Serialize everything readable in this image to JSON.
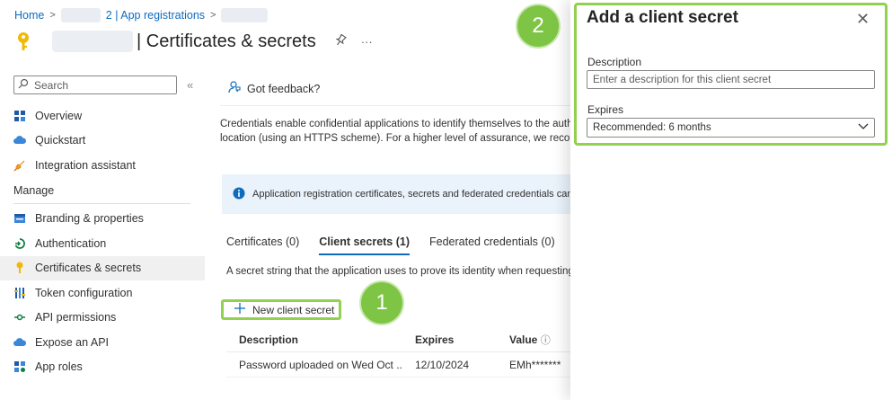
{
  "breadcrumb": {
    "home": "Home",
    "app_registrations": "2 | App registrations"
  },
  "page": {
    "title": "| Certificates & secrets",
    "pin_label": "Pin",
    "more_label": "···"
  },
  "sidebar": {
    "search_placeholder": "Search",
    "collapse_label": "«",
    "items_top": [
      {
        "label": "Overview"
      },
      {
        "label": "Quickstart"
      },
      {
        "label": "Integration assistant"
      }
    ],
    "manage_header": "Manage",
    "items_manage": [
      {
        "label": "Branding & properties"
      },
      {
        "label": "Authentication"
      },
      {
        "label": "Certificates & secrets",
        "active": true
      },
      {
        "label": "Token configuration"
      },
      {
        "label": "API permissions"
      },
      {
        "label": "Expose an API"
      },
      {
        "label": "App roles"
      }
    ]
  },
  "main": {
    "feedback_label": "Got feedback?",
    "description_line1": "Credentials enable confidential applications to identify themselves to the auth",
    "description_line2": "location (using an HTTPS scheme). For a higher level of assurance, we recomm",
    "info_text": "Application registration certificates, secrets and federated credentials can be",
    "tabs": [
      {
        "label": "Certificates (0)"
      },
      {
        "label": "Client secrets (1)",
        "active": true
      },
      {
        "label": "Federated credentials (0)"
      }
    ],
    "tab_description": "A secret string that the application uses to prove its identity when requesting",
    "new_secret_label": "New client secret",
    "table": {
      "headers": [
        "Description",
        "Expires",
        "Value"
      ],
      "rows": [
        {
          "description": "Password uploaded on Wed Oct ...",
          "expires": "12/10/2024",
          "value": "EMh*******"
        }
      ]
    }
  },
  "badges": {
    "one": "1",
    "two": "2"
  },
  "panel": {
    "title": "Add a client secret",
    "close_label": "✕",
    "description_label": "Description",
    "description_placeholder": "Enter a description for this client secret",
    "expires_label": "Expires",
    "expires_value": "Recommended: 6 months"
  },
  "colors": {
    "accent": "#0f6cbd",
    "highlight": "#92d050",
    "badge": "#7ec545",
    "key": "#f2b807"
  }
}
